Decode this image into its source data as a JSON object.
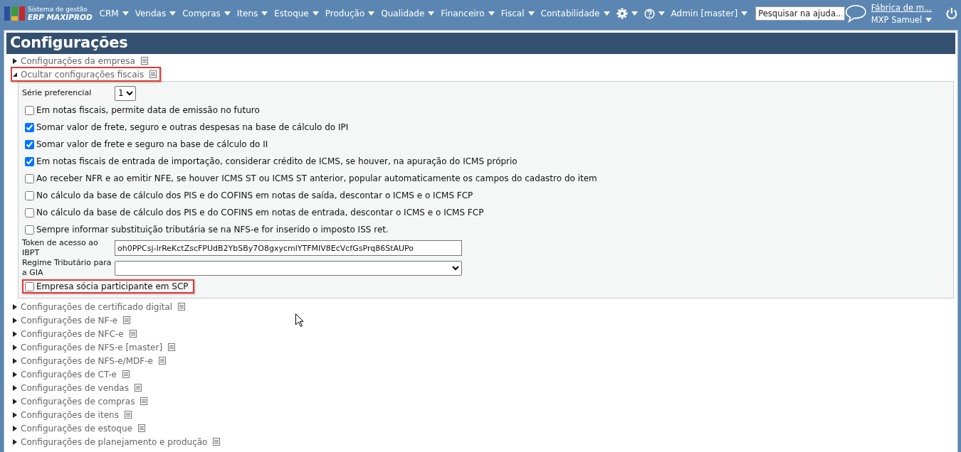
{
  "topbar": {
    "logo": {
      "line1": "Sistema de gestão",
      "line2": "ERP MAXIPROD"
    },
    "menus": [
      {
        "label": "CRM"
      },
      {
        "label": "Vendas"
      },
      {
        "label": "Compras"
      },
      {
        "label": "Itens"
      },
      {
        "label": "Estoque"
      },
      {
        "label": "Produção"
      },
      {
        "label": "Qualidade"
      },
      {
        "label": "Financeiro"
      },
      {
        "label": "Fiscal"
      },
      {
        "label": "Contabilidade"
      }
    ],
    "user_menu": "Admin [master]",
    "search": {
      "placeholder": "Pesquisar na ajuda..."
    },
    "company_link": "Fábrica de m...",
    "user_name": "MXP Samuel"
  },
  "page": {
    "title": "Configurações",
    "sections": [
      {
        "label": "Configurações da empresa",
        "expanded": false,
        "highlighted": false
      },
      {
        "label": "Ocultar configurações fiscais",
        "expanded": true,
        "highlighted": true,
        "fields": [
          {
            "kind": "select",
            "label": "Série preferencial",
            "value": "1"
          },
          {
            "kind": "checkbox",
            "label": "Em notas fiscais, permite data de emissão no futuro",
            "checked": false,
            "highlighted": false
          },
          {
            "kind": "checkbox",
            "label": "Somar valor de frete, seguro e outras despesas na base de cálculo do IPI",
            "checked": true,
            "highlighted": false
          },
          {
            "kind": "checkbox",
            "label": "Somar valor de frete e seguro na base de cálculo do II",
            "checked": true,
            "highlighted": false
          },
          {
            "kind": "checkbox",
            "label": "Em notas fiscais de entrada de importação, considerar crédito de ICMS, se houver, na apuração do ICMS próprio",
            "checked": true,
            "highlighted": false
          },
          {
            "kind": "checkbox",
            "label": "Ao receber NFR e ao emitir NFE, se houver ICMS ST ou ICMS ST anterior, popular automaticamente os campos do cadastro do item",
            "checked": false,
            "highlighted": false
          },
          {
            "kind": "checkbox",
            "label": "No cálculo da base de cálculo dos PIS e do COFINS em notas de saída, descontar o ICMS e o ICMS FCP",
            "checked": false,
            "highlighted": false
          },
          {
            "kind": "checkbox",
            "label": "No cálculo da base de cálculo dos PIS e do COFINS em notas de entrada, descontar o ICMS e o ICMS FCP",
            "checked": false,
            "highlighted": false
          },
          {
            "kind": "checkbox",
            "label": "Sempre informar substituição tributária se na NFS-e for inserido o imposto ISS ret.",
            "checked": false,
            "highlighted": false
          },
          {
            "kind": "text",
            "label": "Token de acesso ao IBPT",
            "value": "oh0PPCsj-IrReKctZscFPUdB2YbSBy7O8gxycmlYTFMIV8EcVcfGsPrq86StAUPo"
          },
          {
            "kind": "wideselect",
            "label": "Regime Tributário para a GIA"
          },
          {
            "kind": "checkbox",
            "label": "Empresa sócia participante em SCP",
            "checked": false,
            "highlighted": true
          }
        ]
      },
      {
        "label": "Configurações de certificado digital",
        "expanded": false,
        "highlighted": false
      },
      {
        "label": "Configurações de NF-e",
        "expanded": false,
        "highlighted": false
      },
      {
        "label": "Configurações de NFC-e",
        "expanded": false,
        "highlighted": false
      },
      {
        "label": "Configurações de NFS-e [master]",
        "expanded": false,
        "highlighted": false
      },
      {
        "label": "Configurações de NFS-e/MDF-e",
        "expanded": false,
        "highlighted": false
      },
      {
        "label": "Configurações de CT-e",
        "expanded": false,
        "highlighted": false
      },
      {
        "label": "Configurações de vendas",
        "expanded": false,
        "highlighted": false
      },
      {
        "label": "Configurações de compras",
        "expanded": false,
        "highlighted": false
      },
      {
        "label": "Configurações de itens",
        "expanded": false,
        "highlighted": false
      },
      {
        "label": "Configurações de estoque",
        "expanded": false,
        "highlighted": false
      },
      {
        "label": "Configurações de planejamento e produção",
        "expanded": false,
        "highlighted": false
      }
    ]
  }
}
